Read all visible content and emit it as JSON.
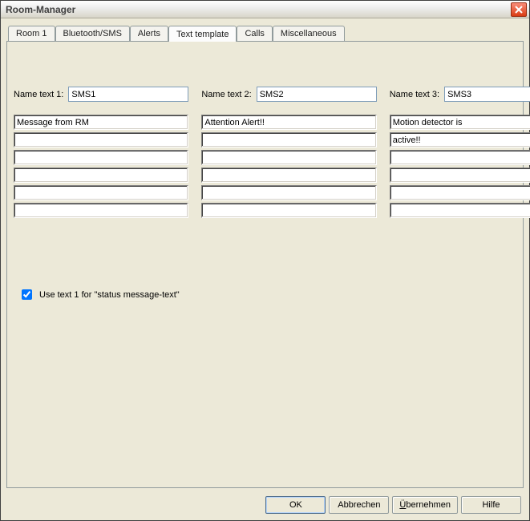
{
  "window": {
    "title": "Room-Manager"
  },
  "tabs": [
    {
      "label": "Room 1"
    },
    {
      "label": "Bluetooth/SMS"
    },
    {
      "label": "Alerts"
    },
    {
      "label": "Text template"
    },
    {
      "label": "Calls"
    },
    {
      "label": "Miscellaneous"
    }
  ],
  "active_tab_index": 3,
  "columns": [
    {
      "name_label": "Name text 1:",
      "name_value": "SMS1",
      "lines": [
        "Message from RM",
        "",
        "",
        "",
        "",
        ""
      ]
    },
    {
      "name_label": "Name text 2:",
      "name_value": "SMS2",
      "lines": [
        "Attention Alert!!",
        "",
        "",
        "",
        "",
        ""
      ]
    },
    {
      "name_label": "Name text 3:",
      "name_value": "SMS3",
      "lines": [
        "Motion detector is",
        "active!!",
        "",
        "",
        "",
        ""
      ]
    }
  ],
  "checkbox": {
    "label": "Use text 1 for \"status message-text\"",
    "checked": true
  },
  "buttons": {
    "ok": "OK",
    "cancel": "Abbrechen",
    "apply": "Übernehmen",
    "help": "Hilfe"
  }
}
